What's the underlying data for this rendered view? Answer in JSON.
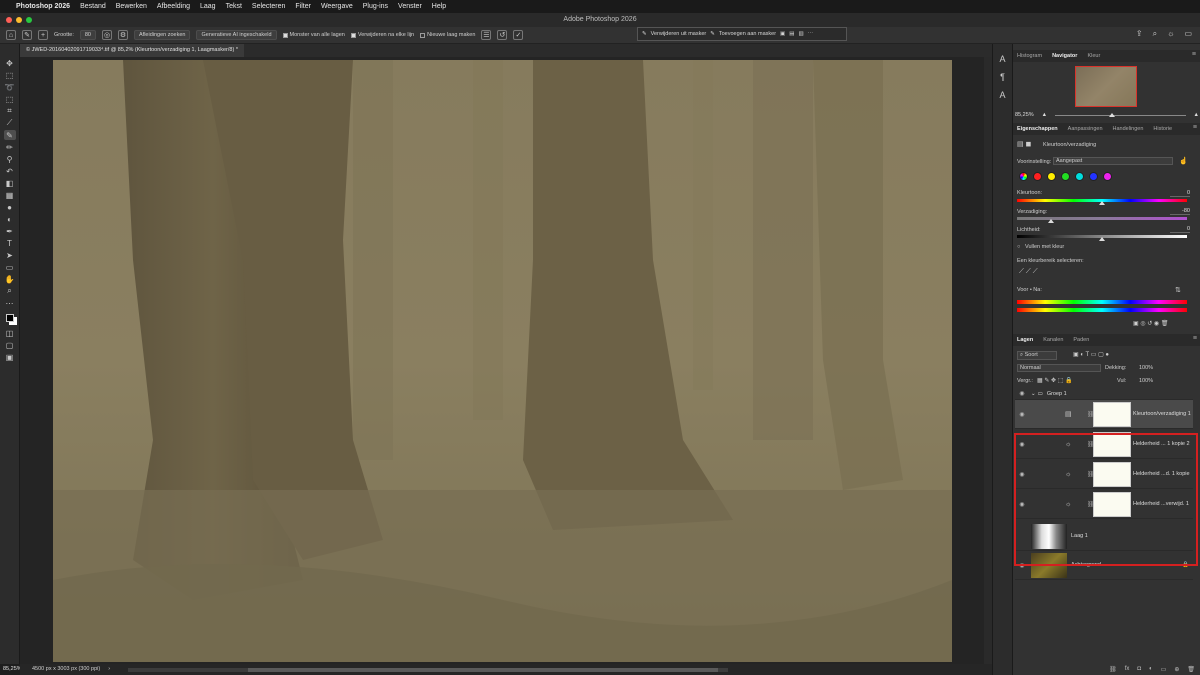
{
  "menubar": {
    "app": "Photoshop 2026",
    "items": [
      "Bestand",
      "Bewerken",
      "Afbeelding",
      "Laag",
      "Tekst",
      "Selecteren",
      "Filter",
      "Weergave",
      "Plug-ins",
      "Venster",
      "Help"
    ]
  },
  "window": {
    "title": "Adobe Photoshop 2026"
  },
  "options": {
    "size_label": "Grootte:",
    "size_value": "80",
    "find_distractions": "Afleidingen zoeken",
    "gen_ai": "Generatieve AI ingeschakeld",
    "sample_all": "Monster van alle lagen",
    "remove_each": "Verwijderen na elke lijn",
    "new_layer": "Nieuwe laag maken",
    "remove_from_mask": "Verwijderen uit masker",
    "add_to_mask": "Toevoegen aan masker"
  },
  "document": {
    "tab_title": "© JWED-20160402091719033⁴.tif @ 85,2% (Kleurtoon/verzadiging 1, Laagmasker/8) *",
    "zoom": "85,25%",
    "status": "4500 px x 3003 px (300 ppi)"
  },
  "navigator": {
    "tabs": [
      "Histogram",
      "Navigator",
      "Kleur"
    ],
    "active_tab": "Navigator",
    "zoom": "85,25%"
  },
  "properties": {
    "tabs": [
      "Eigenschappen",
      "Aanpassingen",
      "Handelingen",
      "Historie"
    ],
    "active_tab": "Eigenschappen",
    "adjustment_name": "Kleurtoon/verzadiging",
    "preset_label": "Voorinstelling:",
    "preset_value": "Aangepast",
    "hue_label": "Kleurtoon:",
    "hue_value": "0",
    "saturation_label": "Verzadiging:",
    "saturation_value": "-80",
    "lightness_label": "Lichtheid:",
    "lightness_value": "0",
    "colorize_label": "Vullen met kleur",
    "range_label": "Een kleurbereik selecteren:",
    "before_after_label": "Voor • Na:",
    "swatch_colors": [
      "#ff2020",
      "#ff2020",
      "#ffee00",
      "#22dd22",
      "#00dddd",
      "#2233ff",
      "#ee22ee"
    ]
  },
  "layers": {
    "tabs": [
      "Lagen",
      "Kanalen",
      "Paden"
    ],
    "active_tab": "Lagen",
    "filter_label": "Soort",
    "blend_mode": "Normaal",
    "opacity_label": "Dekking:",
    "opacity_value": "100%",
    "lock_label": "Vergr.:",
    "fill_label": "Vul:",
    "fill_value": "100%",
    "items": [
      {
        "name": "Groep 1"
      },
      {
        "name": "Kleurtoon/verzadiging 1"
      },
      {
        "name": "Helderheid ... 1 kopie 2"
      },
      {
        "name": "Helderheid ...d. 1 kopie"
      },
      {
        "name": "Helderheid ...verwijd. 1"
      },
      {
        "name": "Laag 1"
      },
      {
        "name": "Achtergrond"
      }
    ]
  },
  "accent": {
    "highlight": "#d42020"
  }
}
